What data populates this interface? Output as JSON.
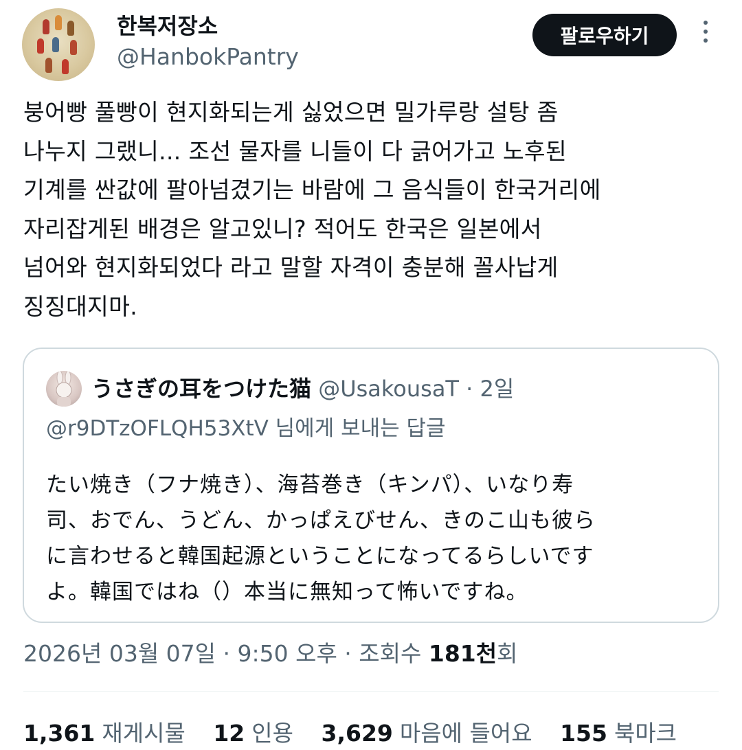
{
  "tweet": {
    "display_name": "한복저장소",
    "handle": "@HanbokPantry",
    "follow_label": "팔로우하기",
    "more_icon": "more-vertical-icon",
    "text": "붕어빵 풀빵이 현지화되는게 싫었으면 밀가루랑 설탕 좀\n나누지 그랬니... 조선 물자를 니들이 다 긁어가고 노후된\n기계를 싼값에 팔아넘겼기는 바람에 그 음식들이 한국거리에\n자리잡게된 배경은 알고있니? 적어도 한국은 일본에서\n넘어와 현지화되었다 라고 말할 자격이 충분해 꼴사납게\n징징대지마.",
    "timestamp": "2026년 03월 07일 · 9:50 오후 · 조회수 ",
    "views_value": "181천",
    "views_suffix": "회"
  },
  "quoted": {
    "display_name": "うさぎの耳をつけた猫",
    "handle": "@UsakousaT",
    "separator": " · ",
    "time": "2일",
    "reply_to": "@r9DTzOFLQH53XtV 님에게 보내는 답글",
    "text": "たい焼き（フナ焼き）、海苔巻き（キンパ）、いなり寿\n司、おでん、うどん、かっぱえびせん、きのこ山も彼ら\nに言わせると韓国起源ということになってるらしいです\nよ。韓国ではね（）本当に無知って怖いですね。"
  },
  "stats": [
    {
      "value": "1,361",
      "label": "재게시물"
    },
    {
      "value": "12",
      "label": "인용"
    },
    {
      "value": "3,629",
      "label": "마음에 들어요"
    },
    {
      "value": "155",
      "label": "북마크"
    }
  ]
}
